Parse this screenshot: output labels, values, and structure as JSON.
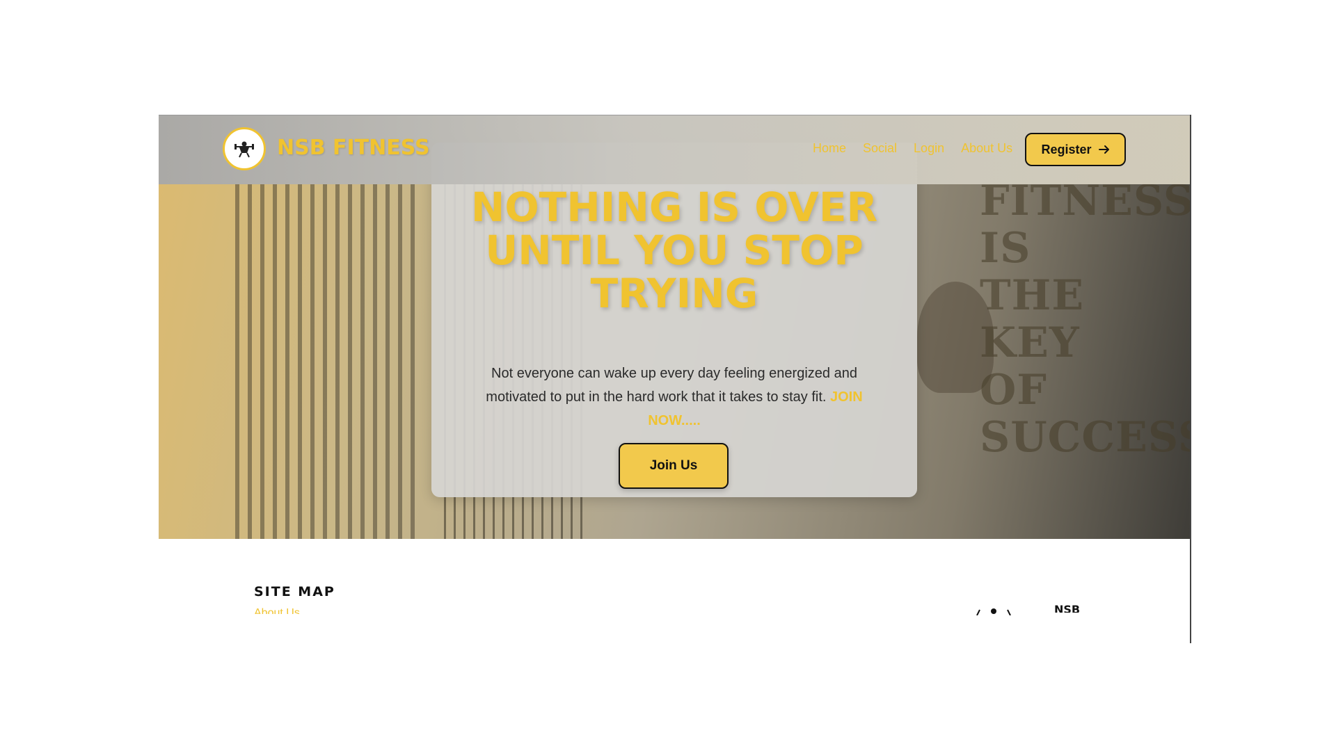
{
  "colors": {
    "accent": "#f0c330",
    "button": "#f2c94c",
    "text": "#2a2a2a"
  },
  "header": {
    "logo_icon": "gym-figure-icon",
    "brand": "NSB FITNESS",
    "nav": [
      "Home",
      "Social",
      "Login",
      "About Us"
    ],
    "register_label": "Register",
    "register_icon": "arrow-right-icon"
  },
  "hero": {
    "headline": [
      "NOTHING IS OVER",
      "UNTIL YOU STOP",
      "TRYING"
    ],
    "description": "Not everyone can wake up every day feeling energized and motivated to put in the hard work that it takes to stay fit.",
    "description_accent": "JOIN NOW.....",
    "cta_label": "Join Us",
    "wall_text": [
      "FITNESS",
      "IS",
      "THE",
      "KEY",
      "OF",
      "SUCCESS"
    ]
  },
  "footer": {
    "site_map_title": "SITE MAP",
    "first_link": "About Us",
    "brand": "NSB"
  }
}
